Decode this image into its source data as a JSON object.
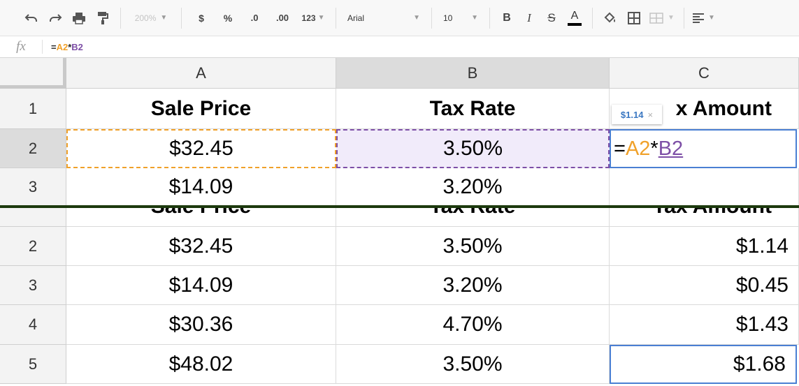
{
  "toolbar": {
    "zoom": "200%",
    "currency": "$",
    "percent": "%",
    "decrease_decimals": ".0",
    "increase_decimals": ".00",
    "more_formats": "123",
    "font": "Arial",
    "font_size": "10",
    "bold": "B",
    "italic": "I",
    "strike": "S",
    "text_color": "A"
  },
  "formula_bar": {
    "fx": "fx",
    "eq": "=",
    "ref_a": "A2",
    "op": "*",
    "ref_b": "B2"
  },
  "columns": [
    "A",
    "B",
    "C"
  ],
  "top_rows": [
    "1",
    "2",
    "3"
  ],
  "top_table": {
    "headers": [
      "Sale Price",
      "Tax Rate",
      "x Amount"
    ],
    "row2": [
      "$32.45",
      "3.50%"
    ],
    "row3": [
      "$14.09",
      "3.20%",
      ""
    ]
  },
  "editor": {
    "eq": "=",
    "ref_a": "A2",
    "op": "*",
    "ref_b": "B2"
  },
  "tooltip": {
    "value": "$1.14",
    "close": "×"
  },
  "bottom_table": {
    "cut_headers": [
      "Sale Price",
      "Tax Rate",
      "Tax Amount"
    ],
    "rows": [
      {
        "n": "2",
        "price": "$32.45",
        "rate": "3.50%",
        "amount": "$1.14"
      },
      {
        "n": "3",
        "price": "$14.09",
        "rate": "3.20%",
        "amount": "$0.45"
      },
      {
        "n": "4",
        "price": "$30.36",
        "rate": "4.70%",
        "amount": "$1.43"
      },
      {
        "n": "5",
        "price": "$48.02",
        "rate": "3.50%",
        "amount": "$1.68"
      }
    ]
  },
  "colors": {
    "ref_a": "#f0a12a",
    "ref_b": "#7d4fa6",
    "selection": "#4a7fd3"
  }
}
